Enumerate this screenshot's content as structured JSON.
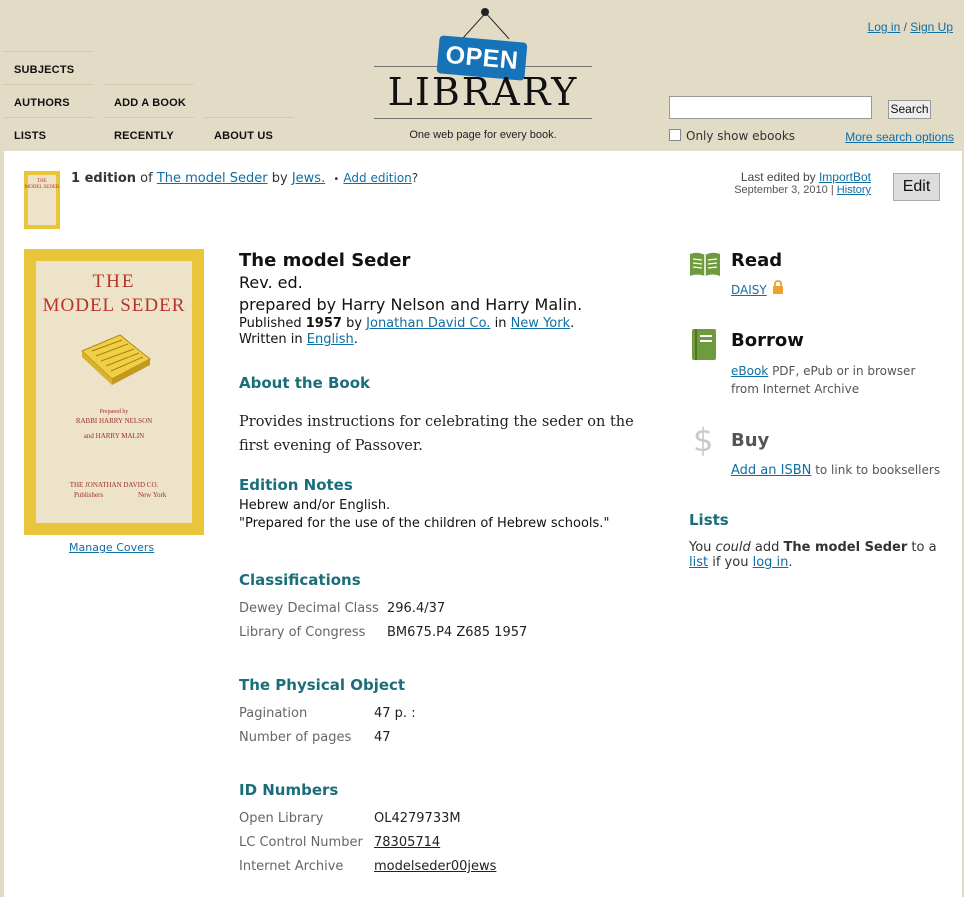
{
  "nav": {
    "subjects": "SUBJECTS",
    "authors": "AUTHORS",
    "add_book": "ADD A BOOK",
    "lists": "LISTS",
    "recently": "RECENTLY",
    "about": "ABOUT US"
  },
  "logo": {
    "sign": "OPEN",
    "word": "LIBRARY",
    "tagline": "One web page for every book."
  },
  "auth": {
    "login": "Log in",
    "sep": "/",
    "signup": "Sign Up"
  },
  "search": {
    "placeholder": "",
    "button": "Search",
    "ebooks_label": "Only show ebooks",
    "more_options": "More search options"
  },
  "edition_bar": {
    "count": "1 edition",
    "of": "of",
    "work_title": "The model Seder",
    "by": "by",
    "author": "Jews.",
    "bullet": "•",
    "add_edition": "Add edition",
    "question": "?",
    "last_edited_by": "Last edited by",
    "editor": "ImportBot",
    "date": "September 3, 2010",
    "divider": "|",
    "history": "History",
    "edit": "Edit"
  },
  "cover": {
    "title_line1": "THE",
    "title_line2": "MODEL SEDER",
    "prepared_by": "Prepared by",
    "author1": "RABBI HARRY NELSON",
    "and": "and HARRY MALIN",
    "publisher": "THE JONATHAN DAVID CO.",
    "publishers_word": "Publishers",
    "city": "New York",
    "manage": "Manage Covers"
  },
  "book": {
    "title": "The model Seder",
    "edition": "Rev. ed.",
    "byline": "prepared by Harry Nelson and Harry Malin.",
    "published_label": "Published",
    "year": "1957",
    "by": "by",
    "publisher": "Jonathan David Co.",
    "in": "in",
    "place": "New York",
    "period": ".",
    "written_in": "Written in",
    "language": "English",
    "lang_period": "."
  },
  "about": {
    "heading": "About the Book",
    "description": "Provides instructions for celebrating the seder on the first evening of Passover."
  },
  "edition_notes": {
    "heading": "Edition Notes",
    "line1": "Hebrew and/or English.",
    "line2": "\"Prepared for the use of the children of Hebrew schools.\""
  },
  "classifications": {
    "heading": "Classifications",
    "rows": [
      {
        "key": "Dewey Decimal Class",
        "value": "296.4/37"
      },
      {
        "key": "Library of Congress",
        "value": "BM675.P4 Z685 1957"
      }
    ]
  },
  "physical": {
    "heading": "The Physical Object",
    "rows": [
      {
        "key": "Pagination",
        "value": "47 p. :"
      },
      {
        "key": "Number of pages",
        "value": "47"
      }
    ]
  },
  "ids": {
    "heading": "ID Numbers",
    "rows": [
      {
        "key": "Open Library",
        "value": "OL4279733M"
      },
      {
        "key": "LC Control Number",
        "value": "78305714"
      },
      {
        "key": "Internet Archive",
        "value": "modelseder00jews"
      }
    ]
  },
  "sidebar": {
    "read": {
      "heading": "Read",
      "link": "DAISY"
    },
    "borrow": {
      "heading": "Borrow",
      "link": "eBook",
      "text1": " PDF, ePub or in browser",
      "text2": "from Internet Archive"
    },
    "buy": {
      "heading": "Buy",
      "link": "Add an ISBN",
      "text": " to link to booksellers"
    },
    "lists": {
      "heading": "Lists",
      "you": "You ",
      "could": "could",
      "add": " add ",
      "title": "The model Seder",
      "to_a": " to a",
      "list": "list",
      "if_you": " if you ",
      "login": "log in",
      "end": "."
    }
  },
  "colors": {
    "header_bg": "#e2dbc6",
    "link": "#0f6ea3",
    "section_heading": "#1a6e7a",
    "logo_sign": "#1673b7",
    "icon_green": "#6f9a3e",
    "lock": "#f0a030"
  }
}
